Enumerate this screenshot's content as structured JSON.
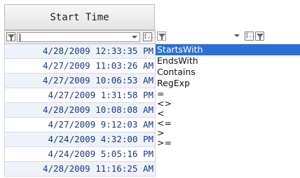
{
  "column": {
    "header": "Start Time"
  },
  "filter": {
    "value": "",
    "filter_icon": "filter-funnel-icon",
    "dropdown_icon": "chevron-down-icon",
    "ellipsis_label": "[...]"
  },
  "rows": [
    "4/28/2009 12:33:35 PM",
    "4/27/2009 11:03:26 AM",
    "4/27/2009 10:06:53 AM",
    "4/27/2009 1:31:58 PM",
    "4/28/2009 10:08:08 AM",
    "4/27/2009 9:12:03 AM",
    "4/24/2009 4:32:00 PM",
    "4/24/2009 5:05:16 PM",
    "4/28/2009 11:16:25 AM"
  ],
  "operators": {
    "selected": "StartsWith",
    "items": [
      "StartsWith",
      "EndsWith",
      "Contains",
      "RegExp",
      "=",
      "<>",
      "<",
      "<=",
      ">",
      ">="
    ]
  },
  "colors": {
    "selection": "#2b6fd6",
    "cell_text": "#1c3a7a"
  }
}
